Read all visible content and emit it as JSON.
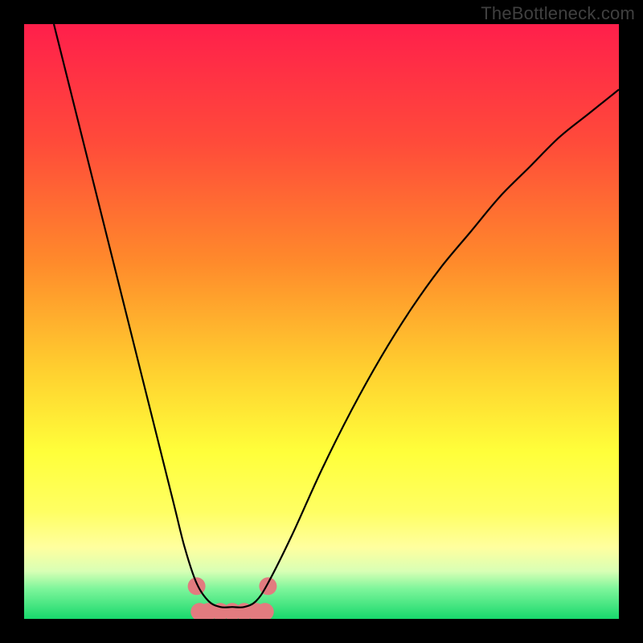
{
  "watermark": "TheBottleneck.com",
  "chart_data": {
    "type": "line",
    "title": "",
    "xlabel": "",
    "ylabel": "",
    "xlim": [
      0,
      100
    ],
    "ylim": [
      0,
      100
    ],
    "series": [
      {
        "name": "curve",
        "x": [
          5,
          10,
          15,
          20,
          25,
          27,
          29,
          31,
          33,
          35,
          37,
          39,
          41,
          45,
          50,
          55,
          60,
          65,
          70,
          75,
          80,
          85,
          90,
          95,
          100
        ],
        "y": [
          100,
          80,
          60,
          40,
          20,
          12,
          6,
          3,
          2,
          2,
          2,
          3,
          6,
          14,
          25,
          35,
          44,
          52,
          59,
          65,
          71,
          76,
          81,
          85,
          89
        ]
      },
      {
        "name": "markers",
        "x": [
          29.5,
          31,
          33,
          35,
          37,
          39,
          40.5,
          29,
          41
        ],
        "y": [
          1.2,
          1.2,
          1.2,
          1.2,
          1.2,
          1.2,
          1.2,
          5.5,
          5.5
        ]
      }
    ],
    "gradient_stops": [
      {
        "offset": 0,
        "color": "#ff1f4b"
      },
      {
        "offset": 20,
        "color": "#ff4b3a"
      },
      {
        "offset": 40,
        "color": "#ff8a2b"
      },
      {
        "offset": 58,
        "color": "#ffcf2f"
      },
      {
        "offset": 72,
        "color": "#ffff3a"
      },
      {
        "offset": 82,
        "color": "#ffff63"
      },
      {
        "offset": 88,
        "color": "#ffff9f"
      },
      {
        "offset": 92,
        "color": "#d8ffb5"
      },
      {
        "offset": 95,
        "color": "#7cf59a"
      },
      {
        "offset": 100,
        "color": "#18d86c"
      }
    ],
    "marker_color": "#e27b7f",
    "curve_color": "#000000"
  }
}
